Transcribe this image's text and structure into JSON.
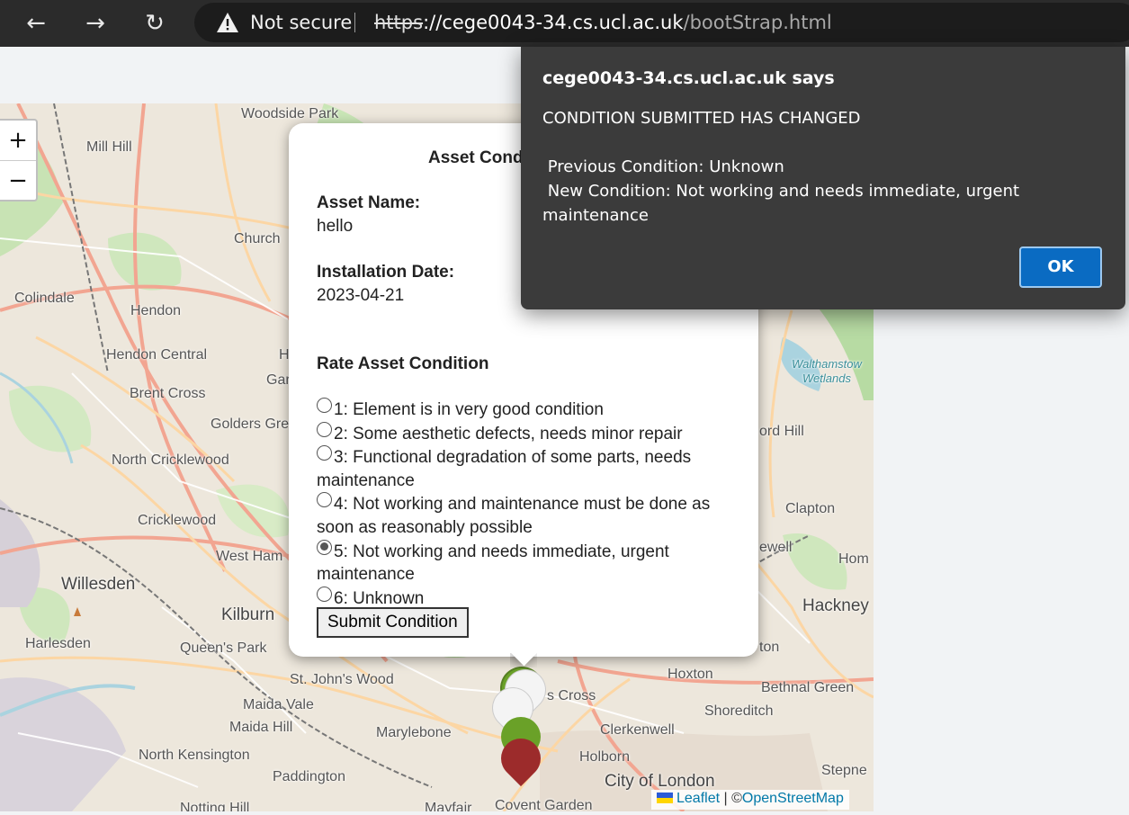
{
  "browser": {
    "back_icon": "←",
    "forward_icon": "→",
    "reload_icon": "↻",
    "security_label": "Not secure",
    "url_protocol": "https",
    "url_host": "://cege0043-34.cs.ucl.ac.uk",
    "url_path": "/bootStrap.html"
  },
  "map": {
    "zoom_in": "+",
    "zoom_out": "−",
    "labels": {
      "woodside_park": "Woodside Park",
      "mill_hill": "Mill Hill",
      "church": "Church",
      "colindale": "Colindale",
      "hendon": "Hendon",
      "hendon_central": "Hendon Central",
      "brent_cross": "Brent Cross",
      "golders_green": "Golders Gre",
      "north_cricklewood": "North Cricklewood",
      "cricklewood": "Cricklewood",
      "west_ham": "West Ham",
      "willesden": "Willesden",
      "kilburn": "Kilburn",
      "harlesden": "Harlesden",
      "queens_park": "Queen's Park",
      "st_johns_wood": "St. John's Wood",
      "maida_vale": "Maida Vale",
      "maida_hill": "Maida Hill",
      "marylebone": "Marylebone",
      "north_kensington": "North Kensington",
      "paddington": "Paddington",
      "notting_hill": "Notting Hill",
      "mayfair": "Mayfair",
      "covent_garden": "Covent Garden",
      "kings_cross": "s Cross",
      "clerkenwell": "Clerkenwell",
      "holborn": "Holborn",
      "city_of_london": "City of London",
      "hoxton": "Hoxton",
      "shoreditch": "Shoreditch",
      "bethnal_green": "Bethnal Green",
      "stepney": "Stepne",
      "hackney": "Hackney",
      "clapton": "Clapton",
      "homerton": "Hom",
      "stoke_newington": "ewell",
      "ston": "ton",
      "ford_hill": "ord Hill",
      "walthamstow_wetlands": "Walthamstow Wetlands",
      "gar": "Gar",
      "h": "H"
    },
    "attribution": {
      "leaflet": "Leaflet",
      "separator": " | ©",
      "osm": "OpenStreetMap"
    }
  },
  "popup": {
    "title": "Asset Cond",
    "asset_name_label": "Asset Name:",
    "asset_name_value": "hello",
    "installation_date_label": "Installation Date:",
    "installation_date_value": "2023-04-21",
    "rate_label": "Rate Asset Condition",
    "options": [
      {
        "label": "1: Element is in very good condition",
        "selected": false
      },
      {
        "label": "2: Some aesthetic defects, needs minor repair",
        "selected": false
      },
      {
        "label": "3: Functional degradation of some parts, needs maintenance",
        "selected": false
      },
      {
        "label": "4: Not working and maintenance must be done as soon as reasonably possible",
        "selected": false
      },
      {
        "label": "5: Not working and needs immediate, urgent maintenance",
        "selected": true
      },
      {
        "label": "6: Unknown",
        "selected": false
      }
    ],
    "submit_label": "Submit Condition"
  },
  "dialog": {
    "title": "cege0043-34.cs.ucl.ac.uk says",
    "message": "CONDITION SUBMITTED HAS CHANGED\n\n Previous Condition: Unknown\n New Condition: Not working and needs immediate, urgent maintenance",
    "ok_label": "OK"
  },
  "colors": {
    "marker_green": "#6aa128",
    "marker_white": "#f4f4f4",
    "marker_red": "#9c2b2b",
    "ok_button": "#0a6bc2"
  }
}
